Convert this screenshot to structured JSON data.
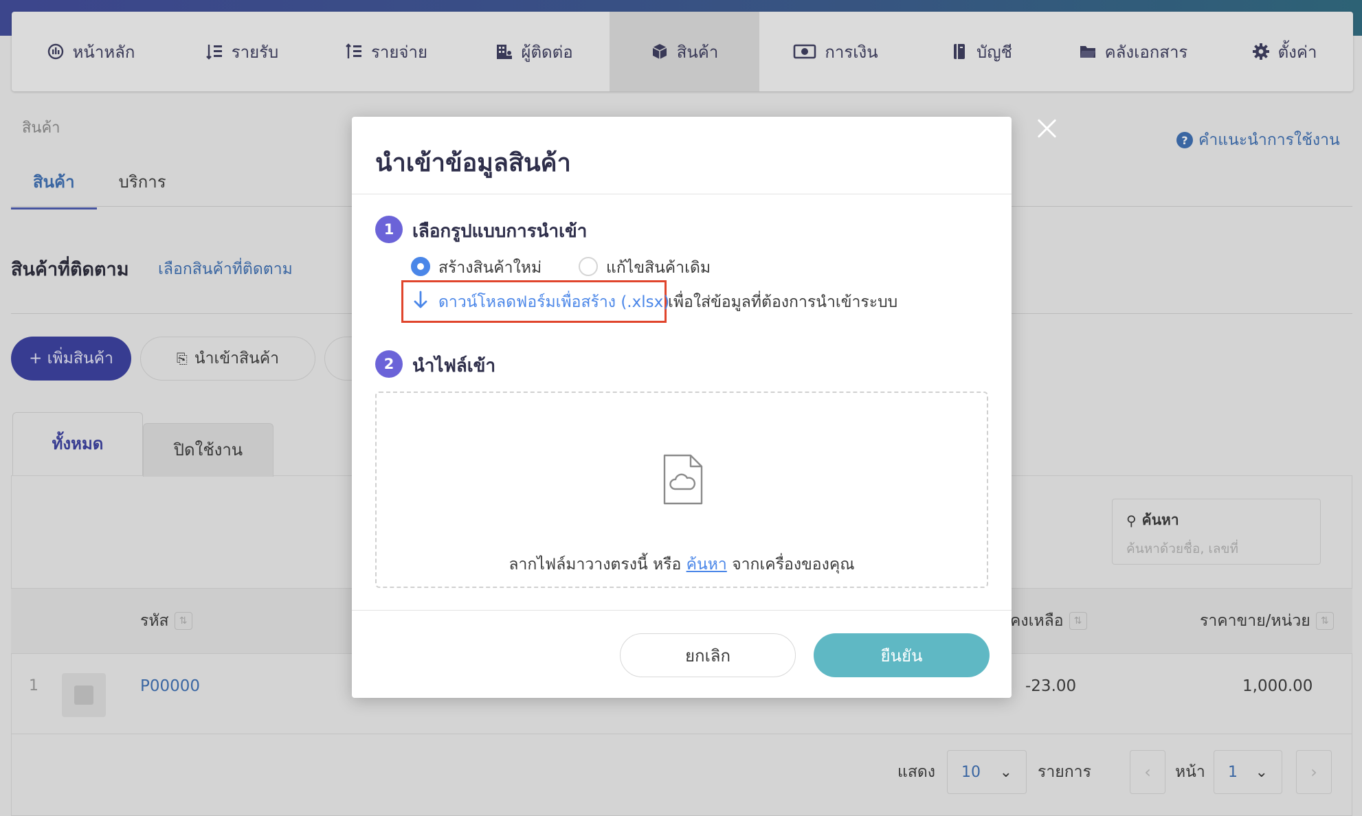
{
  "nav": {
    "items": [
      {
        "label": "หน้าหลัก",
        "icon": "dashboard-icon"
      },
      {
        "label": "รายรับ",
        "icon": "income-icon"
      },
      {
        "label": "รายจ่าย",
        "icon": "expense-icon"
      },
      {
        "label": "ผู้ติดต่อ",
        "icon": "contacts-icon"
      },
      {
        "label": "สินค้า",
        "icon": "box-icon",
        "active": true
      },
      {
        "label": "การเงิน",
        "icon": "money-icon"
      },
      {
        "label": "บัญชี",
        "icon": "book-icon"
      },
      {
        "label": "คลังเอกสาร",
        "icon": "folder-icon"
      },
      {
        "label": "ตั้งค่า",
        "icon": "gear-icon"
      }
    ]
  },
  "page": {
    "breadcrumb": "สินค้า",
    "help_link": "คำแนะนำการใช้งาน",
    "tabs": [
      "สินค้า",
      "บริการ"
    ],
    "watch_title": "สินค้าที่ติดตาม",
    "watch_link": "เลือกสินค้าที่ติดตาม",
    "add_button": "+ เพิ่มสินค้า",
    "import_button": "นำเข้าสินค้า",
    "filter_tabs": [
      "ทั้งหมด",
      "ปิดใช้งาน"
    ],
    "search_label": "ค้นหา",
    "search_placeholder": "ค้นหาด้วยชื่อ, เลขที่",
    "columns": {
      "code": "รหัส",
      "stock": "คงเหลือ",
      "price": "ราคาขาย/หน่วย"
    },
    "row": {
      "num": "1",
      "code": "P00000",
      "stock": "-23.00",
      "price": "1,000.00"
    },
    "pagination": {
      "show_label": "แสดง",
      "page_size": "10",
      "items_label": "รายการ",
      "page_label": "หน้า",
      "page": "1"
    }
  },
  "modal": {
    "title": "นำเข้าข้อมูลสินค้า",
    "step1": {
      "num": "1",
      "title": "เลือกรูปแบบการนำเข้า",
      "option_new": "สร้างสินค้าใหม่",
      "option_edit": "แก้ไขสินค้าเดิม",
      "download_link": "ดาวน์โหลดฟอร์มเพื่อสร้าง (.xlsx)",
      "download_rest": "เพื่อใส่ข้อมูลที่ต้องการนำเข้าระบบ"
    },
    "step2": {
      "num": "2",
      "title": "นำไฟล์เข้า",
      "drop_prefix": "ลากไฟล์มาวางตรงนี้ หรือ ",
      "drop_link": "ค้นหา",
      "drop_suffix": " จากเครื่องของคุณ"
    },
    "cancel": "ยกเลิก",
    "confirm": "ยืนยัน"
  },
  "colors": {
    "accent": "#3a3fa0",
    "link": "#4a86e8",
    "confirm": "#5fb8c4",
    "step": "#6b63d8",
    "highlight": "#e0452c"
  }
}
